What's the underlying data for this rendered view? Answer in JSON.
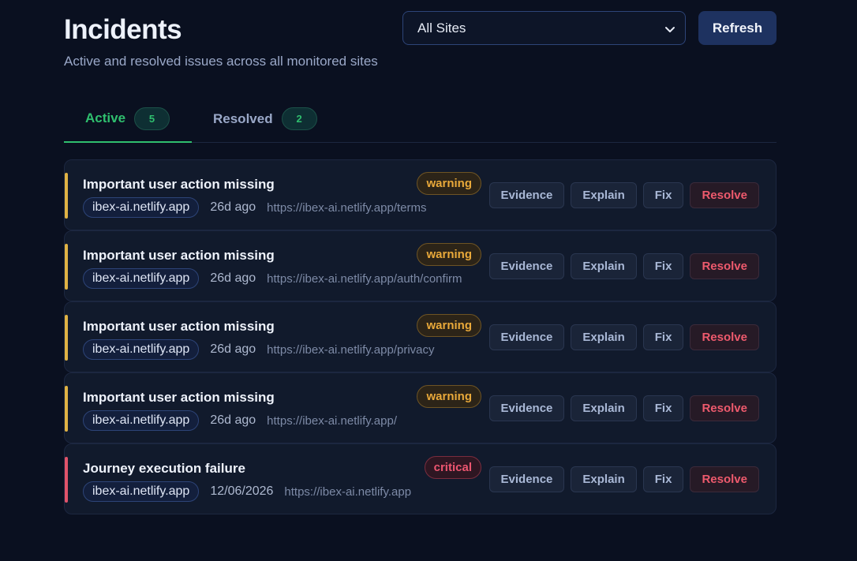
{
  "header": {
    "title": "Incidents",
    "subtitle": "Active and resolved issues across all monitored sites"
  },
  "site_filter": {
    "selected": "All Sites",
    "icon": "chevron-down-icon"
  },
  "refresh_label": "Refresh",
  "tabs": [
    {
      "label": "Active",
      "count": "5",
      "selected": true
    },
    {
      "label": "Resolved",
      "count": "2",
      "selected": false
    }
  ],
  "colors": {
    "accent_green": "#2fbf6e",
    "warning": "#e9a93a",
    "critical": "#ec5670",
    "background": "#0a1020"
  },
  "action_labels": {
    "evidence": "Evidence",
    "explain": "Explain",
    "fix": "Fix",
    "resolve": "Resolve"
  },
  "incidents": [
    {
      "title": "Important user action missing",
      "severity": "warning",
      "site": "ibex-ai.netlify.app",
      "age": "26d ago",
      "url": "https://ibex-ai.netlify.app/terms"
    },
    {
      "title": "Important user action missing",
      "severity": "warning",
      "site": "ibex-ai.netlify.app",
      "age": "26d ago",
      "url": "https://ibex-ai.netlify.app/auth/confirm"
    },
    {
      "title": "Important user action missing",
      "severity": "warning",
      "site": "ibex-ai.netlify.app",
      "age": "26d ago",
      "url": "https://ibex-ai.netlify.app/privacy"
    },
    {
      "title": "Important user action missing",
      "severity": "warning",
      "site": "ibex-ai.netlify.app",
      "age": "26d ago",
      "url": "https://ibex-ai.netlify.app/"
    },
    {
      "title": "Journey execution failure",
      "severity": "critical",
      "site": "ibex-ai.netlify.app",
      "age": "12/06/2026",
      "url": "https://ibex-ai.netlify.app"
    }
  ]
}
